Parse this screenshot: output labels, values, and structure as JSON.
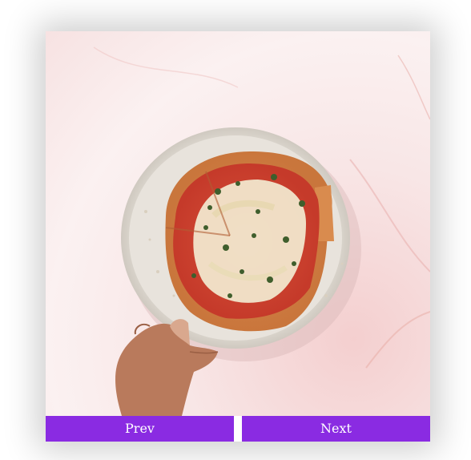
{
  "slideshow": {
    "image_alt": "",
    "prev_label": "Prev",
    "next_label": "Next"
  },
  "colors": {
    "button_bg": "#8a2be2",
    "button_text": "#ffffff",
    "marble": "#f8e6e6"
  }
}
